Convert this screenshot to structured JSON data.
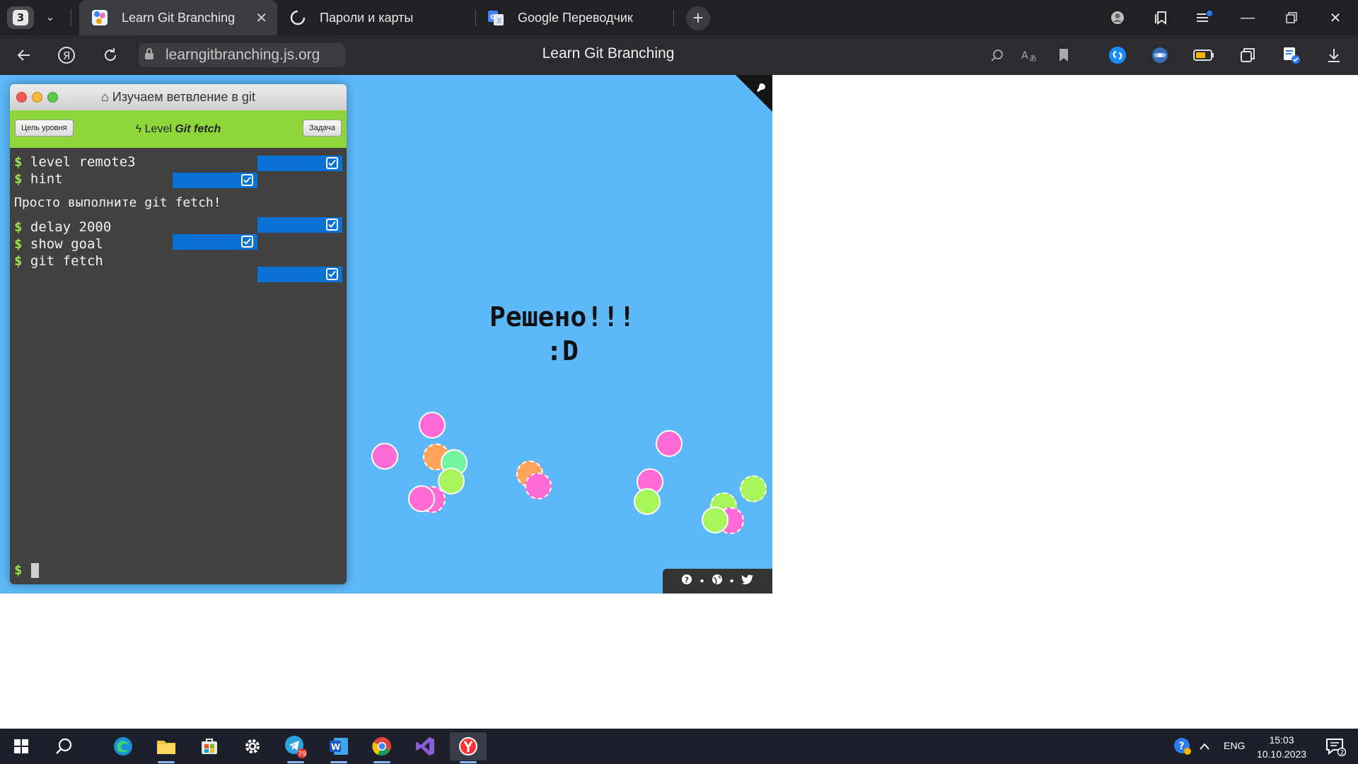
{
  "browser": {
    "tab_count": "3",
    "tabs": [
      {
        "label": "Learn Git Branching",
        "active": true
      },
      {
        "label": "Пароли и карты",
        "active": false
      },
      {
        "label": "Google Переводчик",
        "active": false
      }
    ],
    "url": "learngitbranching.js.org",
    "page_title": "Learn Git Branching"
  },
  "terminal": {
    "title": "Изучаем ветвление в git",
    "goal_button": "Цель уровня",
    "task_button": "Задача",
    "level_prefix": "Level",
    "level_name": "Git fetch",
    "prompt_symbol": "$",
    "commands": [
      {
        "text": "level remote3"
      },
      {
        "text": "hint"
      },
      {
        "text": "delay 2000"
      },
      {
        "text": "show goal"
      },
      {
        "text": "git fetch"
      }
    ],
    "hint_message": "Просто выполните git fetch!"
  },
  "canvas": {
    "solved_line1": "Решено!!!",
    "solved_line2": ":D",
    "background": "#5cb8f7",
    "dot_colors": {
      "pink": "#ff6ad5",
      "orange": "#ffa45c",
      "green": "#a6f55a",
      "mint": "#72f5a0"
    }
  },
  "taskbar": {
    "language": "ENG",
    "time": "15:03",
    "date": "10.10.2023",
    "telegram_badge": "79",
    "notifications_badge": "2",
    "apps": [
      "start-icon",
      "search-icon",
      "edge-icon",
      "file-explorer-icon",
      "store-icon",
      "settings-icon",
      "telegram-icon",
      "word-icon",
      "chrome-icon",
      "visual-studio-icon",
      "yandex-browser-icon"
    ]
  }
}
